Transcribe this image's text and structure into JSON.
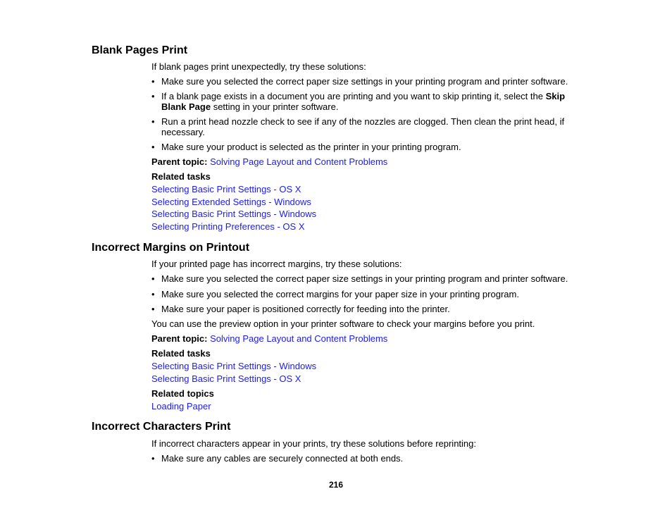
{
  "sections": [
    {
      "title": "Blank Pages Print",
      "intro": "If blank pages print unexpectedly, try these solutions:",
      "bullets": [
        "Make sure you selected the correct paper size settings in your printing program and printer software.",
        {
          "pre": "If a blank page exists in a document you are printing and you want to skip printing it, select the ",
          "bold1": "Skip",
          "bold2": "Blank Page",
          "post": " setting in your printer software."
        },
        {
          "line1": "Run a print head nozzle check to see if any of the nozzles are clogged. Then clean the print head, if",
          "line2": "necessary."
        },
        "Make sure your product is selected as the printer in your printing program."
      ],
      "parent_topic_label": "Parent topic:",
      "parent_topic_link": "Solving Page Layout and Content Problems",
      "related_tasks_label": "Related tasks",
      "related_tasks": [
        "Selecting Basic Print Settings - OS X",
        "Selecting Extended Settings - Windows",
        "Selecting Basic Print Settings - Windows",
        "Selecting Printing Preferences - OS X"
      ]
    },
    {
      "title": "Incorrect Margins on Printout",
      "intro": "If your printed page has incorrect margins, try these solutions:",
      "bullets": [
        "Make sure you selected the correct paper size settings in your printing program and printer software.",
        "Make sure you selected the correct margins for your paper size in your printing program.",
        "Make sure your paper is positioned correctly for feeding into the printer."
      ],
      "note": "You can use the preview option in your printer software to check your margins before you print.",
      "parent_topic_label": "Parent topic:",
      "parent_topic_link": "Solving Page Layout and Content Problems",
      "related_tasks_label": "Related tasks",
      "related_tasks": [
        "Selecting Basic Print Settings - Windows",
        "Selecting Basic Print Settings - OS X"
      ],
      "related_topics_label": "Related topics",
      "related_topics": [
        "Loading Paper"
      ]
    },
    {
      "title": "Incorrect Characters Print",
      "intro": "If incorrect characters appear in your prints, try these solutions before reprinting:",
      "bullets": [
        "Make sure any cables are securely connected at both ends."
      ]
    }
  ],
  "bullet_glyph": "•",
  "page_number": "216",
  "colors": {
    "link": "#1a1aff",
    "text": "#000000"
  }
}
